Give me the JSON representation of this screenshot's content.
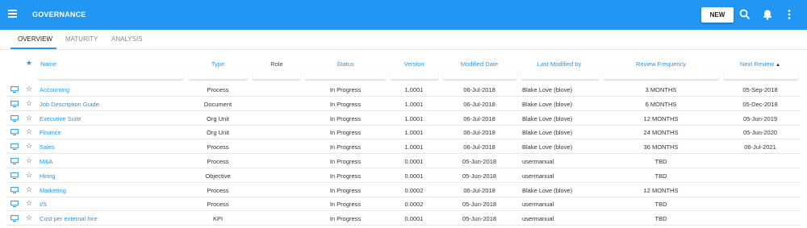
{
  "app": {
    "title": "GOVERNANCE",
    "new_label": "NEW"
  },
  "tabs": [
    {
      "label": "OVERVIEW",
      "active": true
    },
    {
      "label": "MATURITY",
      "active": false
    },
    {
      "label": "ANALYSIS",
      "active": false
    }
  ],
  "columns": {
    "name": "Name",
    "type": "Type",
    "role": "Role",
    "status": "Status",
    "version": "Version",
    "modified_date": "Modified Date",
    "last_modified_by": "Last Modified by",
    "review_frequency": "Review Frequency",
    "next_review": "Next Review",
    "sort_indicator": "▲"
  },
  "colors": {
    "primary": "#2196f3",
    "header_text": "#ffffff"
  },
  "rows": [
    {
      "name": "Accounting",
      "type": "Process",
      "status": "In Progress",
      "version": "1.0001",
      "modified_date": "06-Jul-2018",
      "modified_by": "Blake Love (blove)",
      "frequency": "3 MONTHS",
      "next_review": "05-Sep-2018"
    },
    {
      "name": "Job Description Guide",
      "type": "Document",
      "status": "In Progress",
      "version": "1.0001",
      "modified_date": "06-Jul-2018",
      "modified_by": "Blake Love (blove)",
      "frequency": "6 MONTHS",
      "next_review": "05-Dec-2018"
    },
    {
      "name": "Executive Suite",
      "type": "Org Unit",
      "status": "In Progress",
      "version": "1.0001",
      "modified_date": "06-Jul-2018",
      "modified_by": "Blake Love (blove)",
      "frequency": "12 MONTHS",
      "next_review": "05-Jun-2019"
    },
    {
      "name": "Finance",
      "type": "Org Unit",
      "status": "In Progress",
      "version": "1.0001",
      "modified_date": "06-Jul-2018",
      "modified_by": "Blake Love (blove)",
      "frequency": "24 MONTHS",
      "next_review": "05-Jun-2020"
    },
    {
      "name": "Sales",
      "type": "Process",
      "status": "In Progress",
      "version": "1.0001",
      "modified_date": "06-Jul-2018",
      "modified_by": "Blake Love (blove)",
      "frequency": "36 MONTHS",
      "next_review": "06-Jul-2021"
    },
    {
      "name": "M&A",
      "type": "Process",
      "status": "In Progress",
      "version": "0.0001",
      "modified_date": "05-Jun-2018",
      "modified_by": "usermanual",
      "frequency": "TBD",
      "next_review": ""
    },
    {
      "name": "Hiring",
      "type": "Objective",
      "status": "In Progress",
      "version": "0.0001",
      "modified_date": "05-Jun-2018",
      "modified_by": "usermanual",
      "frequency": "TBD",
      "next_review": ""
    },
    {
      "name": "Marketing",
      "type": "Process",
      "status": "In Progress",
      "version": "0.0002",
      "modified_date": "06-Jul-2018",
      "modified_by": "Blake Love (blove)",
      "frequency": "12 MONTHS",
      "next_review": ""
    },
    {
      "name": "I/S",
      "type": "Process",
      "status": "In Progress",
      "version": "0.0002",
      "modified_date": "05-Jun-2018",
      "modified_by": "usermanual",
      "frequency": "TBD",
      "next_review": ""
    },
    {
      "name": "Cost per external hire",
      "type": "KPI",
      "status": "In Progress",
      "version": "0.0001",
      "modified_date": "05-Jun-2018",
      "modified_by": "usermanual",
      "frequency": "TBD",
      "next_review": ""
    }
  ]
}
